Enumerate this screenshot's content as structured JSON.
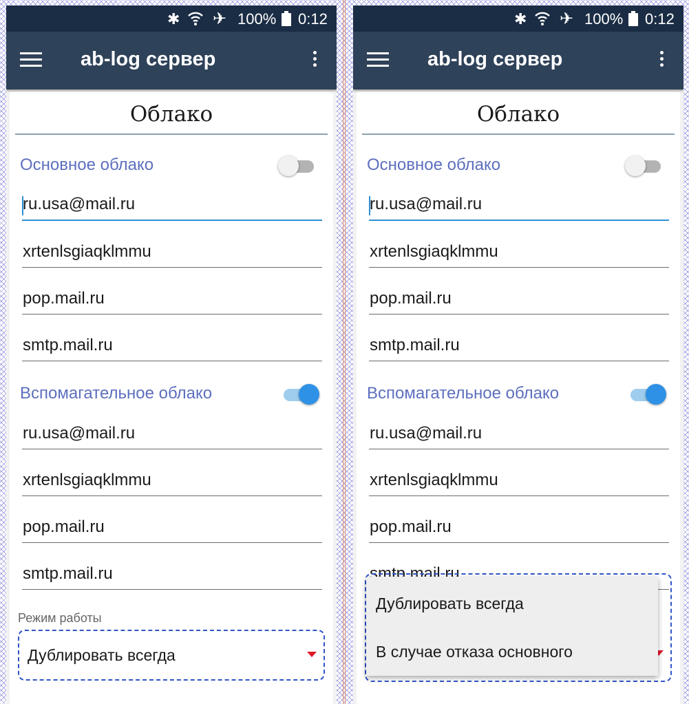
{
  "panels": [
    {
      "status": {
        "battery": "100%",
        "time": "0:12"
      },
      "app_title": "ab-log сервер",
      "card_title": "Облако",
      "primary": {
        "label": "Основное облако",
        "enabled": false,
        "email": "ru.usa@mail.ru",
        "password": "xrtenlsgiaqklmmu",
        "pop": "pop.mail.ru",
        "smtp": "smtp.mail.ru"
      },
      "secondary": {
        "label": "Вспомагательное облако",
        "enabled": true,
        "email": "ru.usa@mail.ru",
        "password": "xrtenlsgiaqklmmu",
        "pop": "pop.mail.ru",
        "smtp": "smtp.mail.ru"
      },
      "mode_label": "Режим работы",
      "mode_value": "Дублировать всегда"
    },
    {
      "status": {
        "battery": "100%",
        "time": "0:12"
      },
      "app_title": "ab-log сервер",
      "card_title": "Облако",
      "primary": {
        "label": "Основное облако",
        "enabled": false,
        "email": "ru.usa@mail.ru",
        "password": "xrtenlsgiaqklmmu",
        "pop": "pop.mail.ru",
        "smtp": "smtp.mail.ru"
      },
      "secondary": {
        "label": "Вспомагательное облако",
        "enabled": true,
        "email": "ru.usa@mail.ru",
        "password": "xrtenlsgiaqklmmu",
        "pop": "pop.mail.ru",
        "smtp": "smtp.mail.ru"
      },
      "dropdown_options": [
        "Дублировать всегда",
        "В случае отказа основного"
      ]
    }
  ],
  "colors": {
    "status_bar": "#1b2d45",
    "toolbar": "#2e4259",
    "section_label": "#5d6fbf",
    "accent": "#2e91e5",
    "spinner_arrow": "#e0192b"
  }
}
